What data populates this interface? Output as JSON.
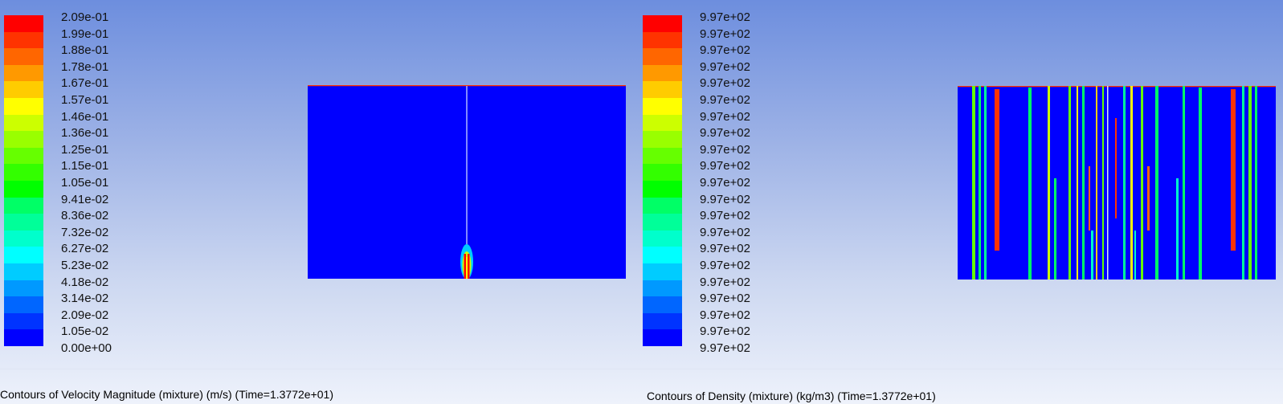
{
  "colormap": [
    "#0000ff",
    "#0033ff",
    "#0066ff",
    "#0099ff",
    "#00ccff",
    "#00ffff",
    "#00ffcc",
    "#00ff99",
    "#00ff66",
    "#00ff00",
    "#33ff00",
    "#66ff00",
    "#99ff00",
    "#ccff00",
    "#ffff00",
    "#ffcc00",
    "#ff9900",
    "#ff6600",
    "#ff3300",
    "#ff0000"
  ],
  "panels": [
    {
      "caption": "Contours of Velocity Magnitude (mixture)  (m/s)  (Time=1.3772e+01)",
      "labels": [
        "2.09e-01",
        "1.99e-01",
        "1.88e-01",
        "1.78e-01",
        "1.67e-01",
        "1.57e-01",
        "1.46e-01",
        "1.36e-01",
        "1.25e-01",
        "1.15e-01",
        "1.05e-01",
        "9.41e-02",
        "8.36e-02",
        "7.32e-02",
        "6.27e-02",
        "5.23e-02",
        "4.18e-02",
        "3.14e-02",
        "2.09e-02",
        "1.05e-02",
        "0.00e+00"
      ],
      "field_color": "#0000ff"
    },
    {
      "caption": "Contours of Density (mixture)  (kg/m3)  (Time=1.3772e+01)",
      "labels": [
        "9.97e+02",
        "9.97e+02",
        "9.97e+02",
        "9.97e+02",
        "9.97e+02",
        "9.97e+02",
        "9.97e+02",
        "9.97e+02",
        "9.97e+02",
        "9.97e+02",
        "9.97e+02",
        "9.97e+02",
        "9.97e+02",
        "9.97e+02",
        "9.97e+02",
        "9.97e+02",
        "9.97e+02",
        "9.97e+02",
        "9.97e+02",
        "9.97e+02",
        "9.97e+02"
      ],
      "field_color": "#0000ff"
    }
  ]
}
